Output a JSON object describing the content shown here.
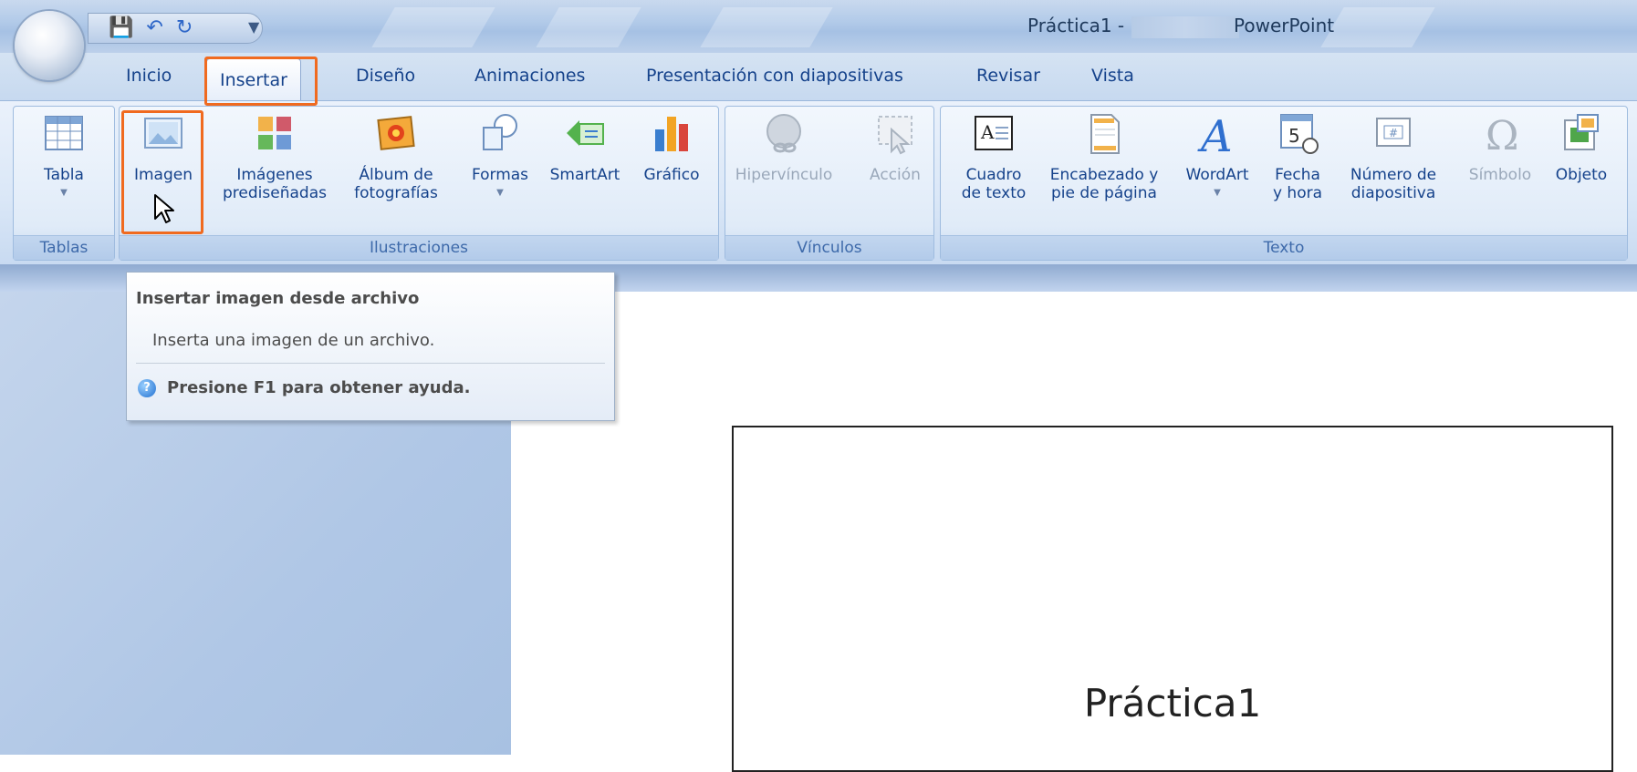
{
  "window": {
    "title_prefix": "Práctica1 -",
    "title_app": "PowerPoint"
  },
  "quick_access": {
    "icons": [
      "save-icon",
      "undo-icon",
      "redo-icon",
      "customize-icon"
    ],
    "more": "▼"
  },
  "tabs": [
    {
      "label": "Inicio"
    },
    {
      "label": "Insertar",
      "active": true
    },
    {
      "label": "Diseño"
    },
    {
      "label": "Animaciones"
    },
    {
      "label": "Presentación con diapositivas"
    },
    {
      "label": "Revisar"
    },
    {
      "label": "Vista"
    }
  ],
  "groups": {
    "tablas": {
      "label": "Tablas",
      "buttons": [
        {
          "label": "Tabla",
          "icon": "table-icon"
        }
      ]
    },
    "ilustraciones": {
      "label": "Ilustraciones",
      "buttons": [
        {
          "label": "Imagen",
          "icon": "picture-icon"
        },
        {
          "label": "Imágenes\nprediseñadas",
          "icon": "clipart-icon"
        },
        {
          "label": "Álbum de\nfotografías",
          "icon": "photo-album-icon"
        },
        {
          "label": "Formas",
          "icon": "shapes-icon"
        },
        {
          "label": "SmartArt",
          "icon": "smartart-icon"
        },
        {
          "label": "Gráfico",
          "icon": "chart-icon"
        }
      ]
    },
    "vinculos": {
      "label": "Vínculos",
      "buttons": [
        {
          "label": "Hipervínculo",
          "icon": "hyperlink-icon"
        },
        {
          "label": "Acción",
          "icon": "action-icon"
        }
      ]
    },
    "texto": {
      "label": "Texto",
      "buttons": [
        {
          "label": "Cuadro\nde texto",
          "icon": "text-box-icon"
        },
        {
          "label": "Encabezado y\npie de página",
          "icon": "header-footer-icon"
        },
        {
          "label": "WordArt",
          "icon": "wordart-icon"
        },
        {
          "label": "Fecha\ny hora",
          "icon": "date-time-icon"
        },
        {
          "label": "Número de\ndiapositiva",
          "icon": "slide-number-icon"
        },
        {
          "label": "Símbolo",
          "icon": "symbol-icon"
        },
        {
          "label": "Objeto",
          "icon": "object-icon"
        }
      ]
    }
  },
  "tooltip": {
    "title": "Insertar imagen desde archivo",
    "description": "Inserta una imagen de un archivo.",
    "help": "Presione F1 para obtener ayuda."
  },
  "slide": {
    "title": "Práctica1"
  },
  "colors": {
    "highlight": "#f06a1f",
    "ribbon_text": "#15428b"
  }
}
